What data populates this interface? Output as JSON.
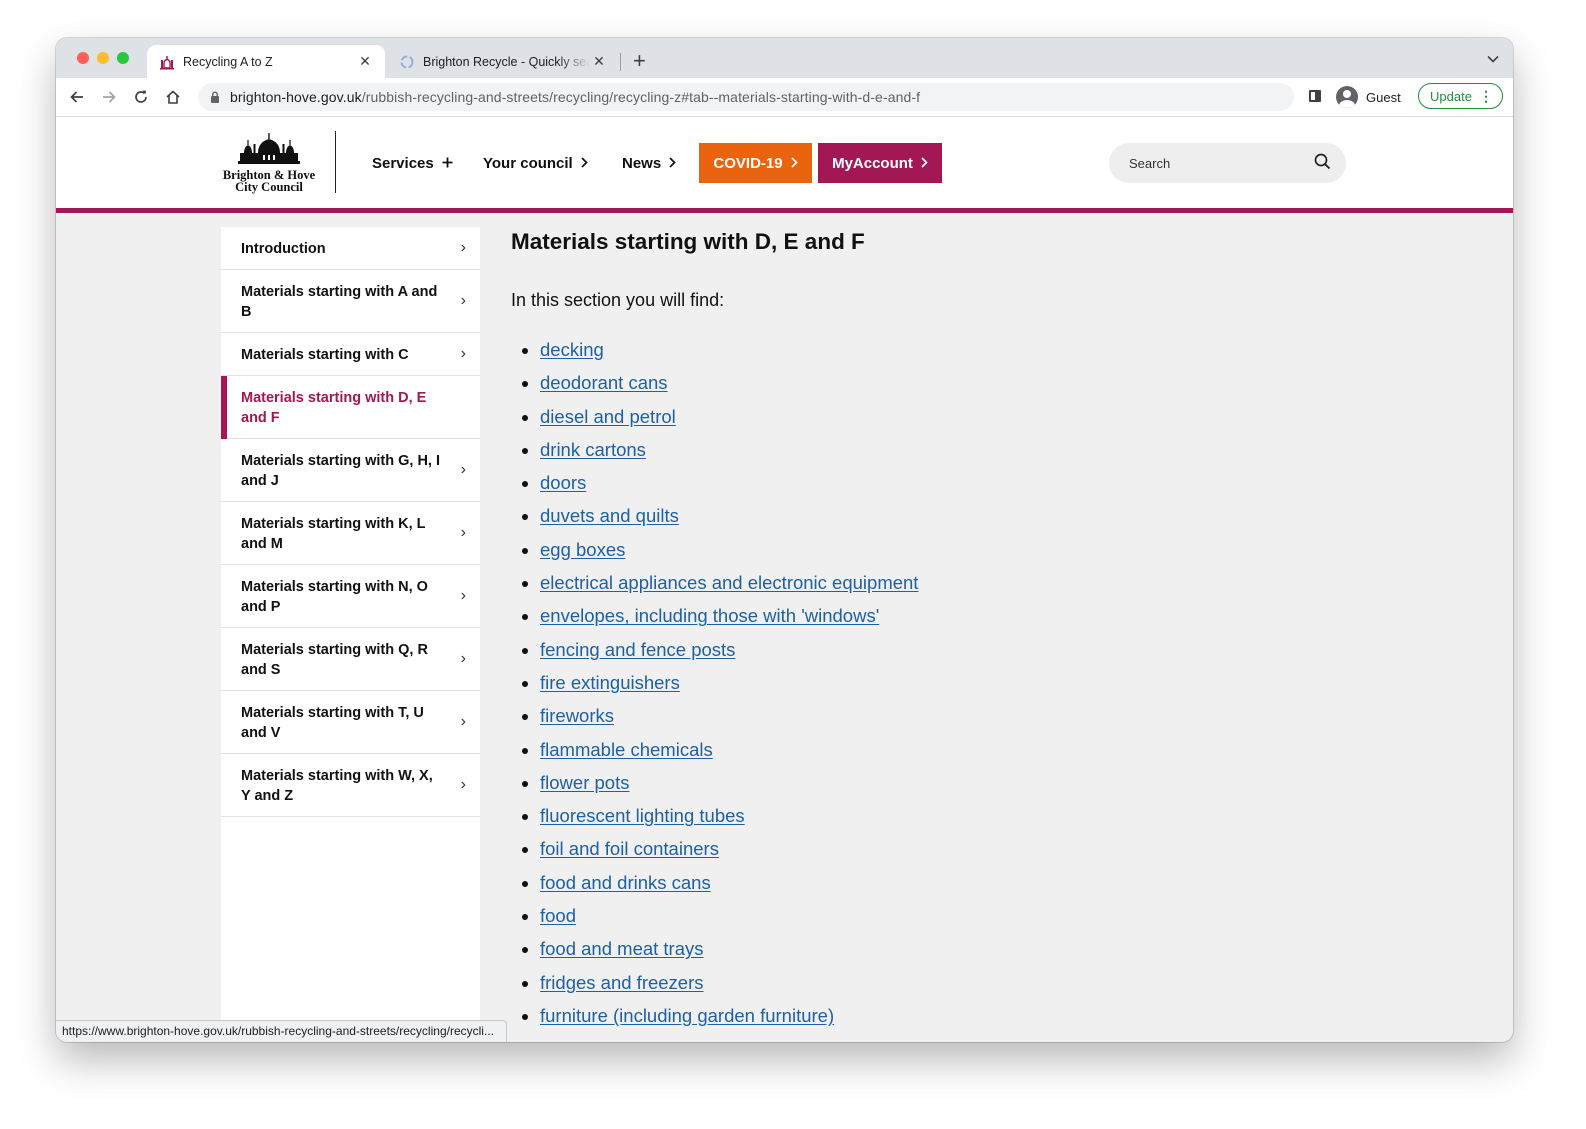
{
  "browser": {
    "tabs": [
      {
        "title": "Recycling A to Z",
        "active": true
      },
      {
        "title": "Brighton Recycle - Quickly search",
        "active": false
      }
    ],
    "close_glyph": "✕",
    "new_tab_glyph": "+",
    "url_host": "brighton-hove.gov.uk",
    "url_path": "/rubbish-recycling-and-streets/recycling/recycling-z#tab--materials-starting-with-d-e-and-f",
    "profile_label": "Guest",
    "update_label": "Update",
    "status_url": "https://www.brighton-hove.gov.uk/rubbish-recycling-and-streets/recycling/recycli..."
  },
  "header": {
    "logo_line1": "Brighton & Hove",
    "logo_line2": "City Council",
    "nav": [
      {
        "label": "Services",
        "icon": "plus-icon"
      },
      {
        "label": "Your council",
        "icon": "chevron-right-icon"
      },
      {
        "label": "News",
        "icon": "chevron-right-icon"
      }
    ],
    "covid_label": "COVID-19",
    "myaccount_label": "MyAccount",
    "search_placeholder": "Search",
    "brand_color": "#a31755",
    "covid_color": "#ea640f"
  },
  "sidebar": {
    "items": [
      {
        "label": "Introduction"
      },
      {
        "label": "Materials starting with A and B"
      },
      {
        "label": "Materials starting with C"
      },
      {
        "label": "Materials starting with D, E and F",
        "active": true
      },
      {
        "label": "Materials starting with G, H, I and J"
      },
      {
        "label": "Materials starting with K, L and M"
      },
      {
        "label": "Materials starting with N, O and P"
      },
      {
        "label": "Materials starting with Q, R and S"
      },
      {
        "label": "Materials starting with T, U and V"
      },
      {
        "label": "Materials starting with W, X, Y and Z"
      }
    ]
  },
  "main": {
    "heading": "Materials starting with D, E and F",
    "intro": "In this section you will find:",
    "link_color": "#1d60a5",
    "links": [
      "decking",
      "deodorant cans",
      "diesel and petrol",
      "drink cartons",
      "doors",
      "duvets and quilts",
      "egg boxes",
      "electrical appliances and electronic equipment",
      "envelopes, including those with 'windows'",
      "fencing and fence posts",
      "fire extinguishers",
      "fireworks",
      "flammable chemicals",
      "flower pots",
      "fluorescent lighting tubes",
      "foil and foil containers",
      "food and drinks cans",
      "food",
      "food and meat trays",
      "fridges and freezers",
      "furniture (including garden furniture)"
    ]
  }
}
